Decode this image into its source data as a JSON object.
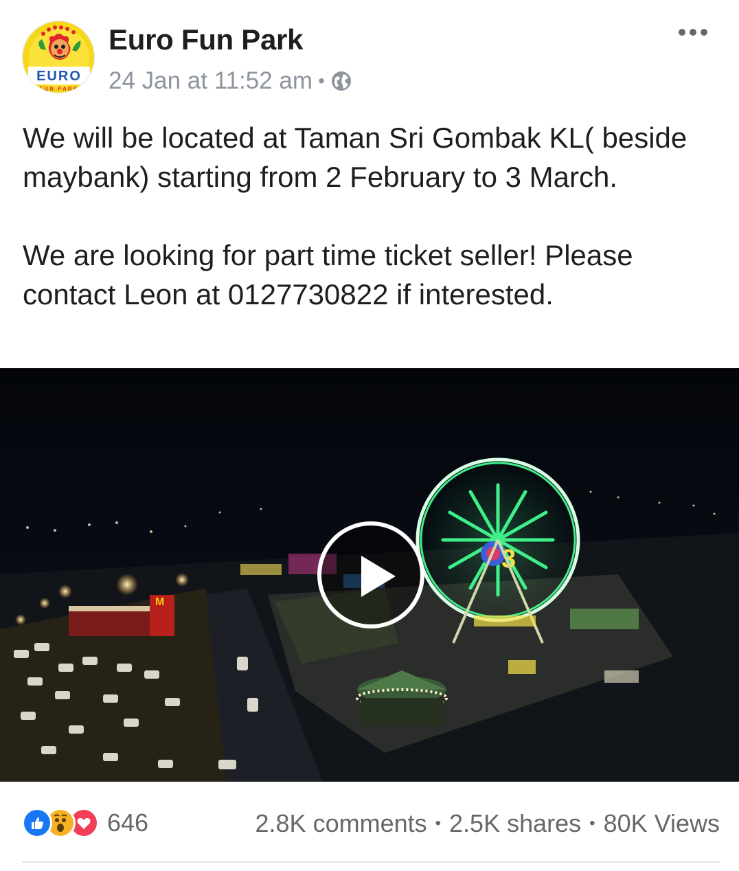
{
  "post": {
    "page_name": "Euro Fun Park",
    "timestamp": "24 Jan at 11:52 am",
    "separator": "•",
    "privacy_icon": "globe-icon",
    "more_icon": "more-options-icon",
    "text_paragraph_1": "We will be located at Taman Sri Gombak KL( beside maybank) starting from 2 February to 3 March.",
    "text_paragraph_2": "We are looking for part time ticket seller! Please contact Leon at 0127730822 if interested."
  },
  "avatar": {
    "logo_text": "EURO",
    "logo_subtext": "FUN PARK"
  },
  "video": {
    "play_icon": "play-icon"
  },
  "footer": {
    "reaction_icons": [
      "like-icon",
      "wow-icon",
      "love-icon"
    ],
    "reaction_count": "646",
    "comments": "2.8K comments",
    "shares": "2.5K shares",
    "views": "80K Views",
    "separator": "•"
  },
  "colors": {
    "like": "#1877f2",
    "wow": "#f7b125",
    "love": "#f33e58",
    "meta_text": "#8d949e",
    "primary_text": "#1c1e21"
  }
}
